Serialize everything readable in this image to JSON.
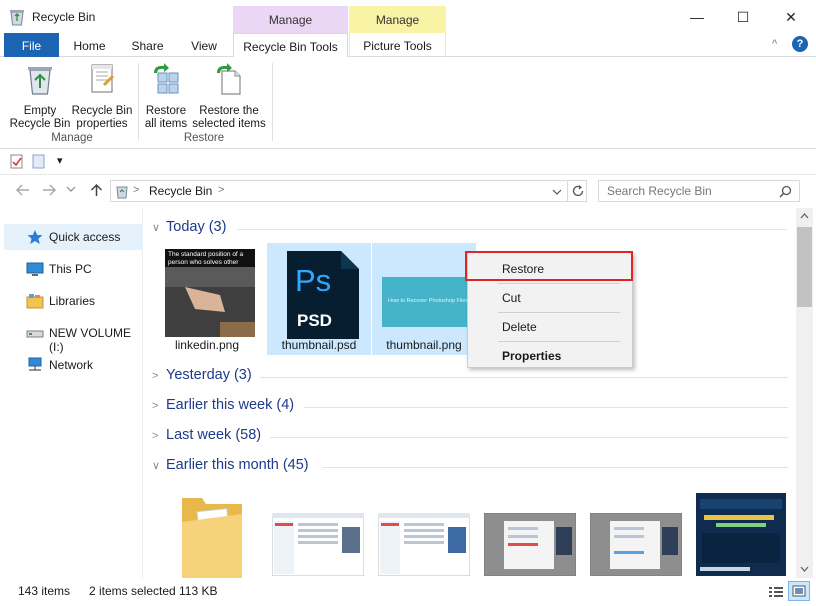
{
  "window": {
    "title": "Recycle Bin",
    "controls": {
      "minimize": "—",
      "maximize": "☐",
      "close": "✕"
    }
  },
  "ribbon": {
    "context_headers": [
      "Manage",
      "Manage"
    ],
    "tabs": [
      "File",
      "Home",
      "Share",
      "View",
      "Recycle Bin Tools",
      "Picture Tools"
    ],
    "collapse_glyph": "^",
    "help_glyph": "?",
    "groups": [
      {
        "label": "Manage",
        "buttons": [
          {
            "line1": "Empty",
            "line2": "Recycle Bin"
          },
          {
            "line1": "Recycle Bin",
            "line2": "properties"
          }
        ]
      },
      {
        "label": "Restore",
        "buttons": [
          {
            "line1": "Restore",
            "line2": "all items"
          },
          {
            "line1": "Restore the",
            "line2": "selected items"
          }
        ]
      }
    ]
  },
  "qat": {
    "dropdown_glyph": "▾"
  },
  "address": {
    "breadcrumb": "Recycle Bin",
    "sep": ">",
    "search_placeholder": "Search Recycle Bin"
  },
  "nav_pane": [
    {
      "label": "Quick access",
      "icon": "star-icon"
    },
    {
      "label": "This PC",
      "icon": "monitor-icon"
    },
    {
      "label": "Libraries",
      "icon": "library-icon"
    },
    {
      "label": "NEW VOLUME (I:)",
      "icon": "drive-icon"
    },
    {
      "label": "Network",
      "icon": "network-icon"
    }
  ],
  "groups": [
    {
      "label": "Today (3)",
      "expanded": true
    },
    {
      "label": "Yesterday (3)",
      "expanded": false
    },
    {
      "label": "Earlier this week (4)",
      "expanded": false
    },
    {
      "label": "Last week (58)",
      "expanded": false
    },
    {
      "label": "Earlier this month (45)",
      "expanded": true
    }
  ],
  "today_files": [
    {
      "name": "linkedin.png",
      "selected": false,
      "caption": "The standard position of a person who solves other person's problems"
    },
    {
      "name": "thumbnail.psd",
      "selected": true,
      "badge_top": "Ps",
      "badge_bottom": "PSD"
    },
    {
      "name": "thumbnail.png",
      "selected": true,
      "caption": "How to Recover Photoshop Files"
    }
  ],
  "context_menu": {
    "items": [
      "Restore",
      "Cut",
      "Delete",
      "Properties"
    ],
    "highlighted": "Restore",
    "accent": "#e12424"
  },
  "status": {
    "count": "143 items",
    "selection": "2 items selected",
    "size": "113 KB"
  },
  "colors": {
    "file_tab": "#1b64b4",
    "group_header": "#1e3a8a",
    "selection": "#cce8ff",
    "manage_purple": "#e9d7f5",
    "manage_yellow": "#f9f3a6"
  }
}
